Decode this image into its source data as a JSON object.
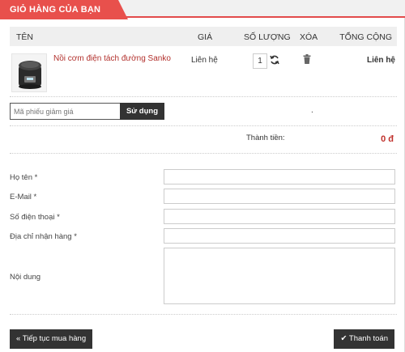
{
  "header": {
    "title": "GIỎ HÀNG CỦA BẠN"
  },
  "table": {
    "columns": [
      "TÊN",
      "GIÁ",
      "SỐ LƯỢNG",
      "XÓA",
      "TỔNG CỘNG"
    ],
    "items": [
      {
        "name": "Nồi cơm điện tách đường Sanko",
        "price": "Liên hệ",
        "quantity": "1",
        "total": "Liên hệ"
      }
    ]
  },
  "coupon": {
    "placeholder": "Mã phiếu giảm giá",
    "button": "Sử dụng",
    "note": "."
  },
  "summary": {
    "label": "Thành tiền:",
    "value": "0 đ"
  },
  "form": {
    "name_label": "Họ tên *",
    "email_label": "E-Mail *",
    "phone_label": "Số điện thoại *",
    "address_label": "Địa chỉ nhận hàng *",
    "content_label": "Nội dung"
  },
  "actions": {
    "continue": "Tiếp tục mua hàng",
    "checkout": "Thanh toán"
  },
  "colors": {
    "accent": "#e8504c",
    "price": "#b2302c",
    "dark": "#333333"
  },
  "icons": {
    "refresh": "refresh-icon",
    "delete": "trash-icon",
    "back": "double-chevron-left-icon",
    "check": "check-icon"
  }
}
